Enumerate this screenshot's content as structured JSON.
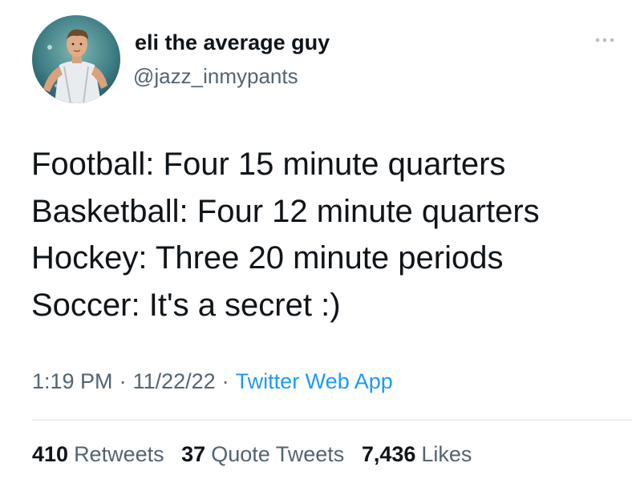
{
  "author": {
    "display_name": "eli the average guy",
    "handle": "@jazz_inmypants",
    "avatar_icon": "user-avatar"
  },
  "tweet": {
    "lines": [
      "Football: Four 15 minute quarters",
      "Basketball: Four 12 minute quarters",
      "Hockey: Three 20 minute periods",
      "Soccer: It's a secret :)"
    ]
  },
  "meta": {
    "time": "1:19 PM",
    "separator": "·",
    "date": "11/22/22",
    "source": "Twitter Web App"
  },
  "stats": {
    "retweets_count": "410",
    "retweets_label": "Retweets",
    "quotes_count": "37",
    "quotes_label": "Quote Tweets",
    "likes_count": "7,436",
    "likes_label": "Likes"
  },
  "colors": {
    "text_primary": "#0f1419",
    "text_secondary": "#536471",
    "link": "#1d9bf0",
    "divider": "#dfe3e6"
  },
  "icons": {
    "more": "more-icon"
  }
}
